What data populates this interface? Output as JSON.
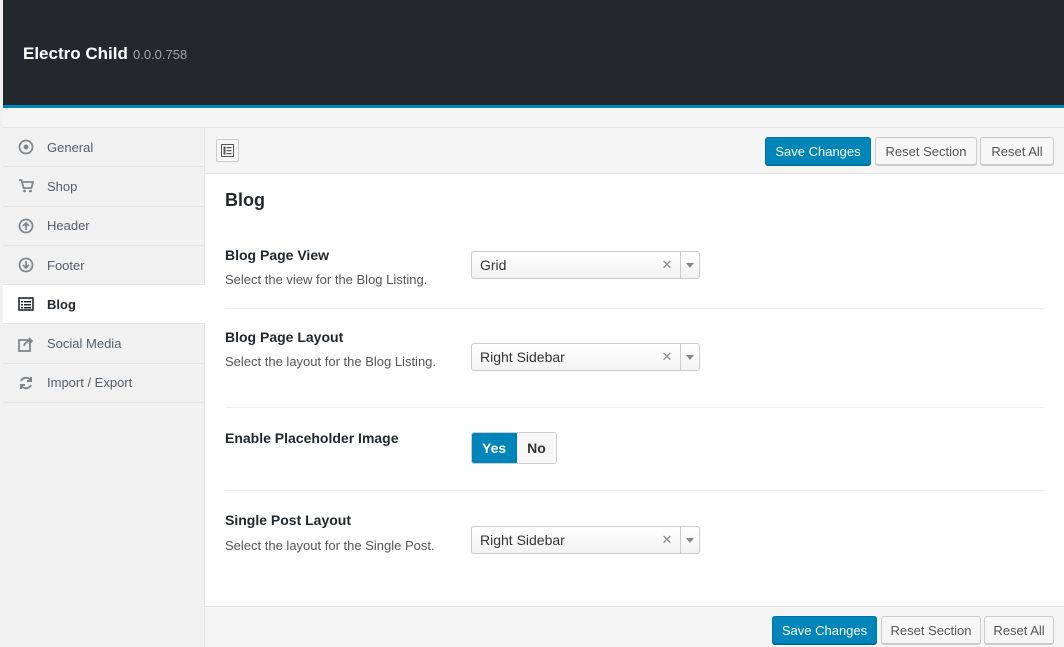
{
  "header": {
    "title": "Electro Child",
    "version": "0.0.0.758"
  },
  "sidebar": {
    "items": [
      {
        "label": "General",
        "icon": "info-circle-icon"
      },
      {
        "label": "Shop",
        "icon": "cart-icon"
      },
      {
        "label": "Header",
        "icon": "arrow-up-circle-icon"
      },
      {
        "label": "Footer",
        "icon": "arrow-down-circle-icon"
      },
      {
        "label": "Blog",
        "icon": "list-alt-icon",
        "active": true
      },
      {
        "label": "Social Media",
        "icon": "share-icon"
      },
      {
        "label": "Import / Export",
        "icon": "refresh-icon"
      }
    ]
  },
  "toolbar": {
    "save_label": "Save Changes",
    "reset_section_label": "Reset Section",
    "reset_all_label": "Reset All"
  },
  "section": {
    "title": "Blog",
    "fields": [
      {
        "label": "Blog Page View",
        "description": "Select the view for the Blog Listing.",
        "type": "select",
        "value": "Grid"
      },
      {
        "label": "Blog Page Layout",
        "description": "Select the layout for the Blog Listing.",
        "type": "select",
        "value": "Right Sidebar"
      },
      {
        "label": "Enable Placeholder Image",
        "description": "",
        "type": "toggle",
        "yes_label": "Yes",
        "no_label": "No",
        "value": "Yes"
      },
      {
        "label": "Single Post Layout",
        "description": "Select the layout for the Single Post.",
        "type": "select",
        "value": "Right Sidebar"
      }
    ]
  },
  "footer": {
    "save_label": "Save Changes",
    "reset_section_label": "Reset Section",
    "reset_all_label": "Reset All"
  },
  "colors": {
    "header_bg": "#23282d",
    "accent": "#0085ba"
  }
}
